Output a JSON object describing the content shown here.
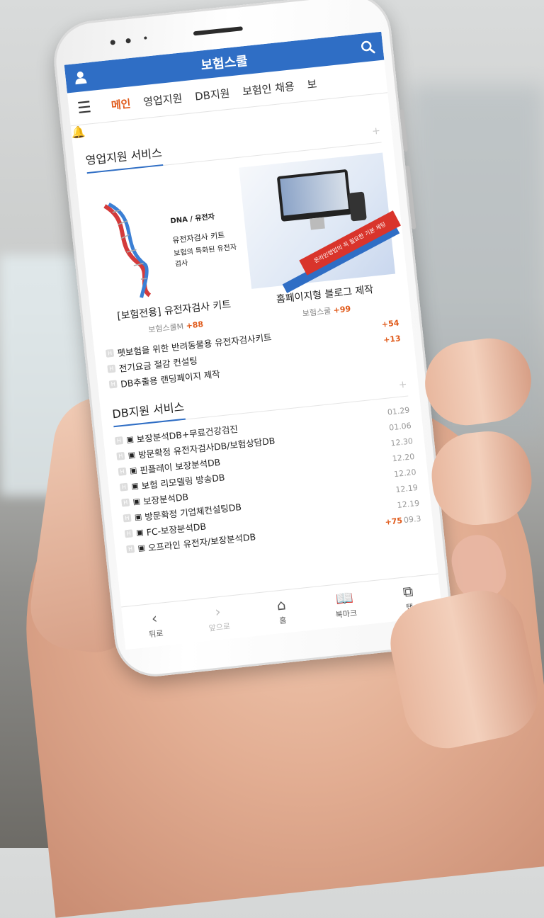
{
  "app": {
    "title": "보험스쿨",
    "icons": {
      "user": "user-icon",
      "search": "search-icon",
      "bell": "bell-icon",
      "menu": "hamburger-menu-icon"
    },
    "colors": {
      "header_blue": "#2f6ec5",
      "accent_orange": "#e05a1a"
    }
  },
  "nav": {
    "tabs": [
      {
        "label": "메인",
        "active": true
      },
      {
        "label": "영업지원"
      },
      {
        "label": "DB지원"
      },
      {
        "label": "보험인 채용"
      },
      {
        "label": "보"
      }
    ]
  },
  "sales_support": {
    "title": "영업지원 서비스",
    "more": "+",
    "cards": [
      {
        "image_caption_small": "DNA / 유전자",
        "image_caption_line1": "유전자검사 키트",
        "image_caption_line2": "보험의 특화된 유전자검사",
        "title": "[보험전용] 유전자검사 키트",
        "author": "보험스쿨M",
        "count": "+88"
      },
      {
        "image_ribbon": "온라인영업의 꼭 필요한 기본 세팅",
        "title": "홈페이지형 블로그 제작",
        "author": "보험스쿨",
        "count": "+99"
      }
    ],
    "list": [
      {
        "title": "펫보험을 위한 반려동물용 유전자검사키트",
        "count": "+54"
      },
      {
        "title": "전기요금 절감 컨설팅",
        "count": "+13"
      },
      {
        "title": "DB추출용 랜딩페이지 제작",
        "count": ""
      }
    ]
  },
  "db_support": {
    "title": "DB지원 서비스",
    "more": "+",
    "list": [
      {
        "title": "보장분석DB+무료건강검진",
        "count": "",
        "date": "01.29"
      },
      {
        "title": "방문확정 유전자검사DB/보험상담DB",
        "count": "",
        "date": "01.06"
      },
      {
        "title": "핀플레이 보장분석DB",
        "count": "",
        "date": "12.30"
      },
      {
        "title": "보험 리모델링 방송DB",
        "count": "",
        "date": "12.20"
      },
      {
        "title": "보장분석DB",
        "count": "",
        "date": "12.20"
      },
      {
        "title": "방문확정 기업체컨설팅DB",
        "count": "",
        "date": "12.19"
      },
      {
        "title": "FC-보장분석DB",
        "count": "",
        "date": "12.19"
      },
      {
        "title": "오프라인 유전자/보장분석DB",
        "count": "+75",
        "date": "09.3"
      }
    ]
  },
  "bottom_bar": [
    {
      "label": "뒤로",
      "icon": "back-icon",
      "glyph": "‹"
    },
    {
      "label": "앞으로",
      "icon": "forward-icon",
      "glyph": "›"
    },
    {
      "label": "홈",
      "icon": "home-icon",
      "glyph": "⌂"
    },
    {
      "label": "북마크",
      "icon": "bookmark-icon",
      "glyph": "📖"
    },
    {
      "label": "탭",
      "icon": "tabs-icon",
      "glyph": "⧉"
    }
  ]
}
